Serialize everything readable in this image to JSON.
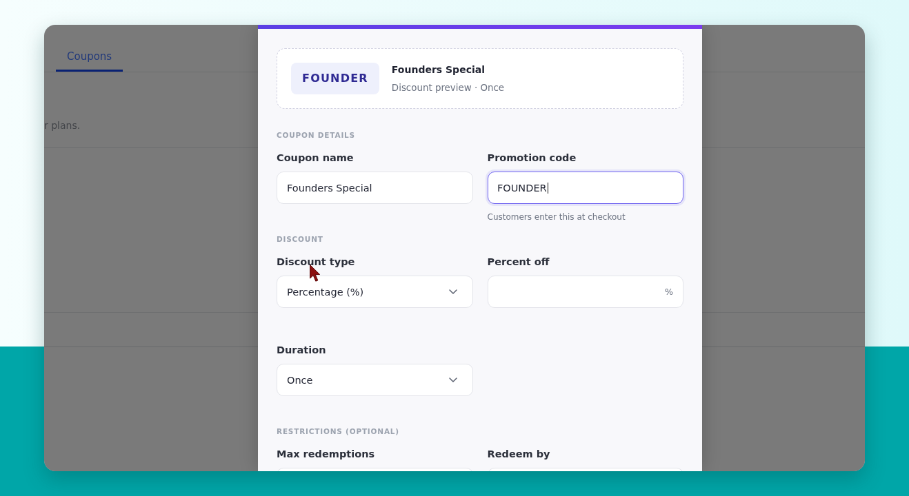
{
  "background_page": {
    "tabs": [
      {
        "label": "Coupons",
        "selected": true
      }
    ],
    "description": "r plans."
  },
  "modal": {
    "preview": {
      "code": "FOUNDER",
      "title": "Founders Special",
      "subtitle": "Discount preview · Once"
    },
    "sections": [
      {
        "title": "COUPON DETAILS",
        "rows": [
          [
            {
              "label": "Coupon name",
              "kind": "text",
              "value": "Founders Special",
              "focused": false
            },
            {
              "label": "Promotion code",
              "kind": "text",
              "value": "FOUNDER",
              "focused": true,
              "helper": "Customers enter this at checkout"
            }
          ]
        ]
      },
      {
        "title": "DISCOUNT",
        "rows": [
          [
            {
              "label": "Discount type",
              "kind": "select",
              "value": "Percentage (%)",
              "focused": false
            },
            {
              "label": "Percent off",
              "kind": "text",
              "suffix": "%",
              "focused": false
            }
          ],
          [
            {
              "label": "Duration",
              "kind": "select",
              "value": "Once",
              "focused": false
            }
          ]
        ]
      },
      {
        "title": "RESTRICTIONS (OPTIONAL)",
        "rows": [
          [
            {
              "label": "Max redemptions",
              "kind": "text",
              "focused": false
            },
            {
              "label": "Redeem by",
              "kind": "text",
              "focused": false
            }
          ]
        ]
      }
    ]
  }
}
